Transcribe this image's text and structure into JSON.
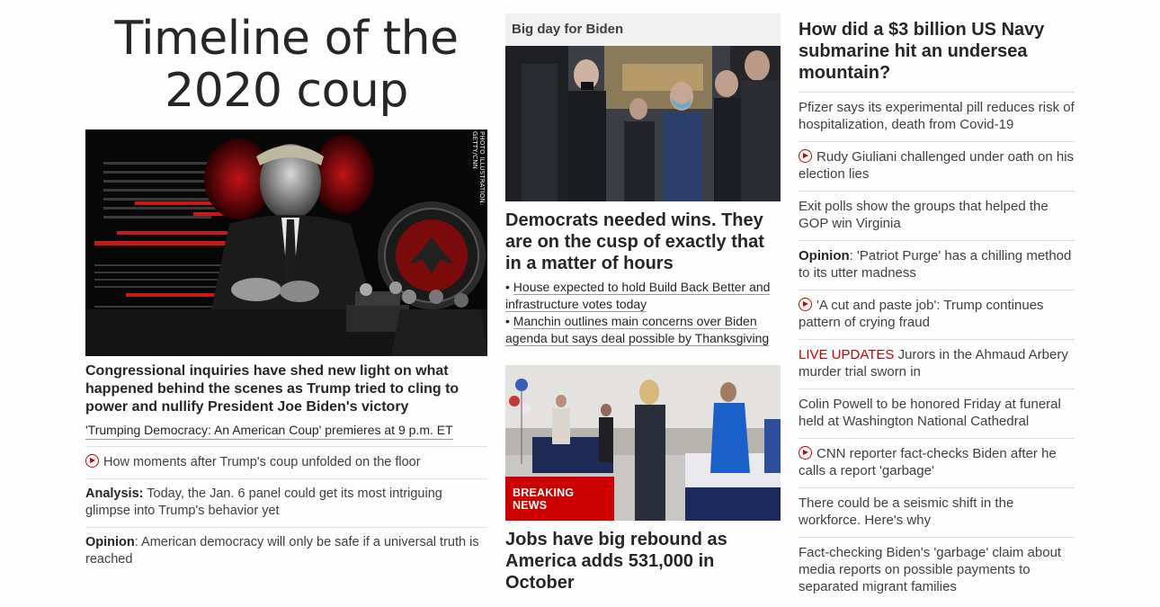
{
  "col1": {
    "headline": "Timeline of the 2020 coup",
    "image_credit": "PHOTO ILLUSTRATION: GETTY/CNN",
    "caption": "Congressional inquiries have shed new light on what happened behind the scenes as Trump tried to cling to power and nullify President Joe Biden's victory",
    "sublink": "'Trumping Democracy: An American Coup' premieres at 9 p.m. ET",
    "items": [
      {
        "label": "",
        "text": "How moments after Trump's coup unfolded on the floor",
        "video": true
      },
      {
        "label": "Analysis:",
        "text": " Today, the Jan. 6 panel could get its most intriguing glimpse into Trump's behavior yet",
        "video": false
      },
      {
        "label": "Opinion",
        "text": ": American democracy will only be safe if a universal truth is reached",
        "video": false
      }
    ]
  },
  "col2": {
    "section_title": "Big day for Biden",
    "headline": "Democrats needed wins. They are on the cusp of exactly that in a matter of hours",
    "bullets": [
      "House expected to hold Build Back Better and infrastructure votes today",
      "Manchin outlines main concerns over Biden agenda but says deal possible by Thanksgiving"
    ],
    "badge": "BREAKING NEWS",
    "headline2": "Jobs have big rebound as America adds 531,000 in October"
  },
  "col3": {
    "headline": "How did a $3 billion US Navy submarine hit an undersea mountain?",
    "items": [
      {
        "video": false,
        "label": "",
        "live": "",
        "text": "Pfizer says its experimental pill reduces risk of hospitalization, death from Covid-19"
      },
      {
        "video": true,
        "label": "",
        "live": "",
        "text": "Rudy Giuliani challenged under oath on his election lies"
      },
      {
        "video": false,
        "label": "",
        "live": "",
        "text": "Exit polls show the groups that helped the GOP win Virginia"
      },
      {
        "video": false,
        "label": "Opinion",
        "live": "",
        "text": ": 'Patriot Purge' has a chilling method to its utter madness"
      },
      {
        "video": true,
        "label": "",
        "live": "",
        "text": "'A cut and paste job': Trump continues pattern of crying fraud"
      },
      {
        "video": false,
        "label": "",
        "live": "LIVE UPDATES",
        "text": " Jurors in the Ahmaud Arbery murder trial sworn in"
      },
      {
        "video": false,
        "label": "",
        "live": "",
        "text": "Colin Powell to be honored Friday at funeral held at Washington National Cathedral"
      },
      {
        "video": true,
        "label": "",
        "live": "",
        "text": "CNN reporter fact-checks Biden after he calls a report 'garbage'"
      },
      {
        "video": false,
        "label": "",
        "live": "",
        "text": "There could be a seismic shift in the workforce. Here's why"
      },
      {
        "video": false,
        "label": "",
        "live": "",
        "text": "Fact-checking Biden's 'garbage' claim about media reports on possible payments to separated migrant families"
      }
    ]
  }
}
